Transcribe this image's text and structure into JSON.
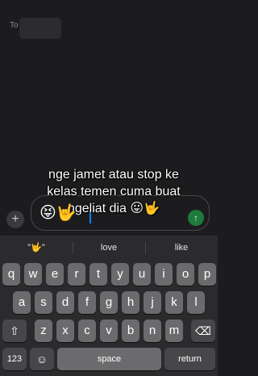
{
  "to_field": {
    "label": "To"
  },
  "caption": {
    "line1": "nge jamet atau stop ke",
    "line2": "kelas temen cuma buat",
    "line3": "ngeliat dia"
  },
  "message": {
    "emoji_prefix": "😝🤟",
    "emoji_suffix": "😛🤟"
  },
  "composer": {
    "plus": "+",
    "send": "↑"
  },
  "suggestions": [
    "\"🤟\"",
    "love",
    "like"
  ],
  "keyboard": {
    "row1": [
      "q",
      "w",
      "e",
      "r",
      "t",
      "y",
      "u",
      "i",
      "o",
      "p"
    ],
    "row2": [
      "a",
      "s",
      "d",
      "f",
      "g",
      "h",
      "j",
      "k",
      "l"
    ],
    "row3": [
      "z",
      "x",
      "c",
      "v",
      "b",
      "n",
      "m"
    ],
    "shift": "⇧",
    "delete": "⌫",
    "numbers": "123",
    "emoji": "☺",
    "space": "space",
    "return": "return"
  }
}
